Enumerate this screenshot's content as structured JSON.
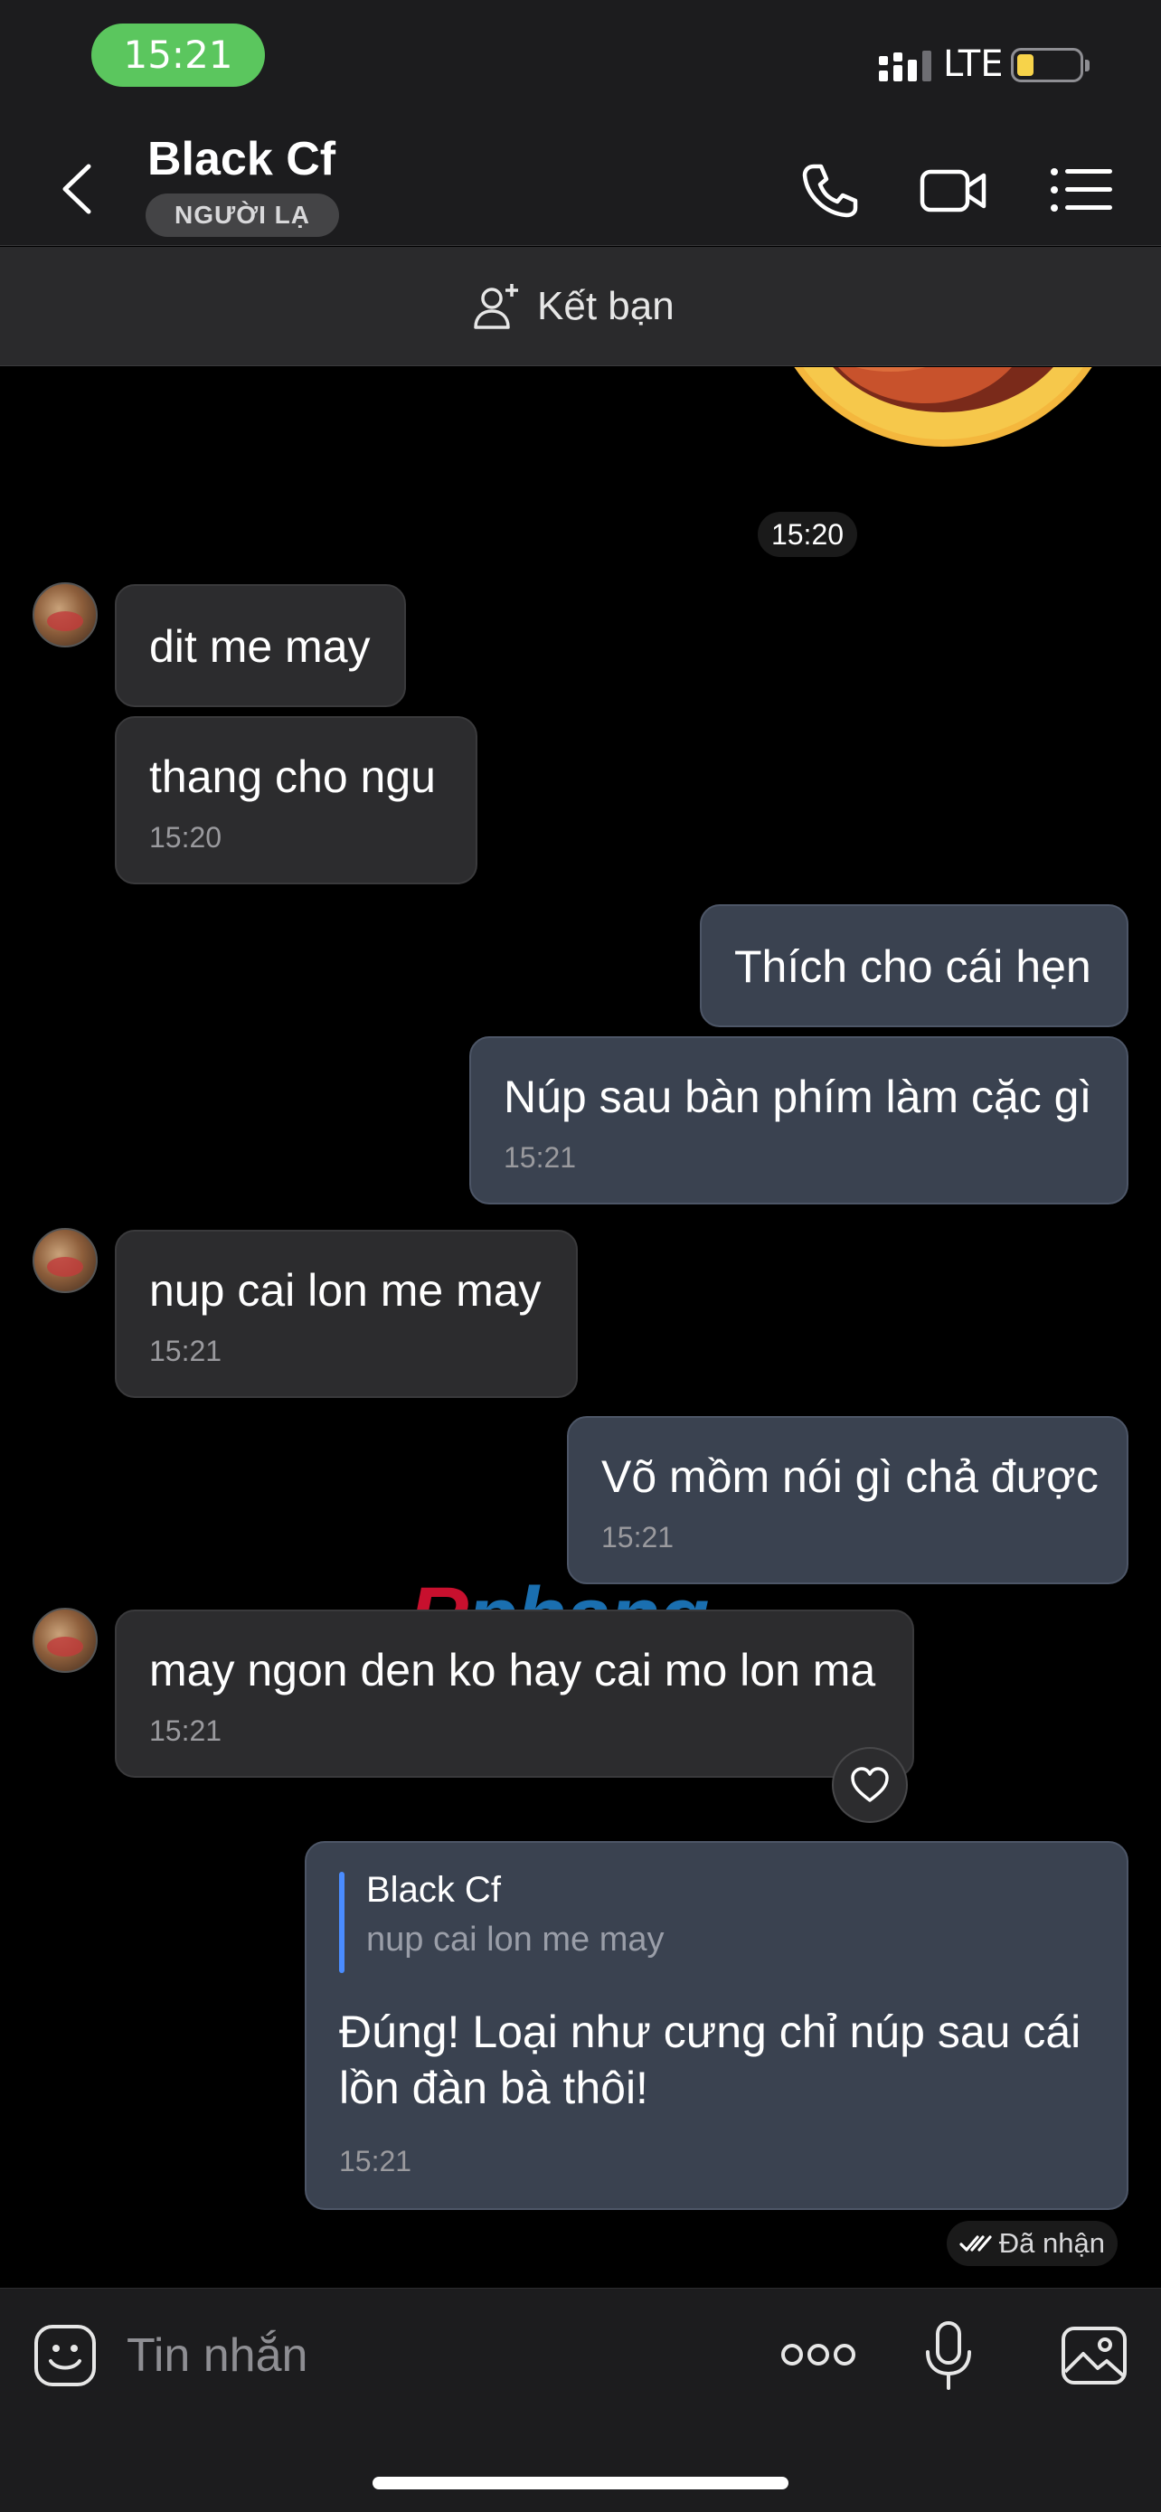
{
  "status_bar": {
    "time": "15:21",
    "network": "LTE"
  },
  "header": {
    "title": "Black Cf",
    "badge": "NGƯỜI LẠ",
    "icons": [
      "back-icon",
      "phone-icon",
      "video-call-icon",
      "menu-list-icon"
    ]
  },
  "friend_bar": {
    "label": "Kết bạn"
  },
  "messages": [
    {
      "side": "out",
      "type": "sticker",
      "time": "15:20"
    },
    {
      "side": "in",
      "text": "dit me may"
    },
    {
      "side": "in",
      "text": "thang cho ngu",
      "time": "15:20"
    },
    {
      "side": "out",
      "text": "Thích cho cái hẹn"
    },
    {
      "side": "out",
      "text": "Núp sau bàn phím làm cặc gì",
      "time": "15:21"
    },
    {
      "side": "in",
      "text": "nup cai lon me may",
      "time": "15:21"
    },
    {
      "side": "out",
      "text": "Võ mồm nói gì chả được",
      "time": "15:21"
    },
    {
      "side": "in",
      "text": "may ngon den ko hay cai mo lon ma",
      "time": "15:21"
    },
    {
      "side": "out",
      "quote": {
        "name": "Black Cf",
        "text": "nup cai lon me may"
      },
      "text": "Đúng! Loại như cưng chỉ núp sau cái lồn đàn bà thôi!",
      "time": "15:21"
    }
  ],
  "delivered_status": "Đã nhận",
  "watermark": {
    "r": "R",
    "rest": "phang"
  },
  "input": {
    "placeholder": "Tin nhắn"
  },
  "colors": {
    "time_pill": "#5bc65e",
    "incoming": "#2c2c2e",
    "outgoing": "#3a4250",
    "quote_accent": "#4a8cff"
  }
}
